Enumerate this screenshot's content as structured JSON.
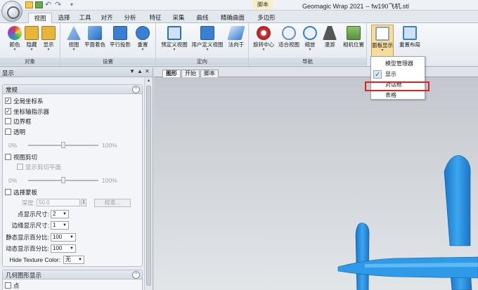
{
  "titlebar": {
    "context_tab": "脚本",
    "window_title": "Geomagic Wrap 2021 -- fw190飞机.stl",
    "quick_access": [
      "new-icon",
      "open-icon",
      "undo-icon",
      "redo-icon"
    ]
  },
  "ribbon_tabs": {
    "items": [
      "视图",
      "选择",
      "工具",
      "对齐",
      "分析",
      "特征",
      "采集",
      "曲线",
      "精确曲面",
      "多边形"
    ],
    "active": "视图"
  },
  "ribbon": {
    "groups": {
      "object": {
        "label": "对象",
        "buttons": [
          {
            "label": "颜色",
            "icon": "color-wheel-icon",
            "color": "#7b5fc7"
          },
          {
            "label": "隐藏",
            "icon": "hide-icon",
            "color": "#e8b53a"
          },
          {
            "label": "显示",
            "icon": "show-icon",
            "color": "#e8b53a"
          }
        ]
      },
      "settings": {
        "label": "设置",
        "buttons": [
          {
            "label": "视图",
            "icon": "view-icon",
            "color": "#5a8fd0"
          },
          {
            "label": "平面着色",
            "icon": "flat-shading-icon",
            "color": "#3b7fd4"
          },
          {
            "label": "平行投影",
            "icon": "parallel-projection-icon",
            "color": "#3b7fd4"
          },
          {
            "label": "重置",
            "icon": "reset-icon",
            "color": "#3b7fd4"
          }
        ]
      },
      "orientation": {
        "label": "定向",
        "buttons": [
          {
            "label": "预定义视图",
            "icon": "predefined-view-icon",
            "color": "#3b7fd4"
          },
          {
            "label": "用户定义视图",
            "icon": "user-view-icon",
            "color": "#3b7fd4"
          },
          {
            "label": "法向于",
            "icon": "normal-to-icon",
            "color": "#3b7fd4"
          }
        ]
      },
      "navigation": {
        "label": "导航",
        "buttons": [
          {
            "label": "旋转中心",
            "icon": "rotation-center-icon",
            "color": "#d43b3b"
          },
          {
            "label": "适合视图",
            "icon": "fit-view-icon",
            "color": "#6f8fb3"
          },
          {
            "label": "缩放",
            "icon": "zoom-icon",
            "color": "#3b7fd4"
          },
          {
            "label": "漫游",
            "icon": "walk-icon",
            "color": "#555555"
          },
          {
            "label": "相机位置",
            "icon": "camera-position-icon",
            "color": "#6fa34c"
          }
        ]
      },
      "layout": {
        "label": "",
        "buttons": [
          {
            "label": "面板显示",
            "icon": "panel-display-icon",
            "color": "#d9a740"
          },
          {
            "label": "重置布局",
            "icon": "reset-layout-icon",
            "color": "#3b7fd4"
          }
        ]
      }
    }
  },
  "panel_menu": {
    "items": [
      "模型管理器",
      "显示",
      "对话框",
      "表格"
    ],
    "checked": "显示",
    "highlighted": "对话框"
  },
  "left_panel": {
    "title": "显示",
    "header_buttons": [
      "▼",
      "▲",
      "✕"
    ],
    "general": {
      "title": "常规",
      "global_cs": {
        "label": "全局坐标系",
        "checked": true
      },
      "axis_indicator": {
        "label": "坐标轴指示器",
        "checked": true
      },
      "bounding_box": {
        "label": "边界框",
        "checked": false
      },
      "transparent": {
        "label": "透明",
        "checked": false
      },
      "transparency_min": "0%",
      "transparency_max": "100%",
      "view_clip": {
        "label": "视图剪切",
        "checked": false
      },
      "show_clip_plane": {
        "label": "显示剪切平面",
        "checked": false
      },
      "clip_min": "0%",
      "clip_max": "100%",
      "select_mask": {
        "label": "选择蒙板",
        "checked": false
      },
      "depth_label": "深度:",
      "depth_value": "50.0",
      "calibrate_button": "校准...",
      "point_size_label": "点显示尺寸:",
      "point_size_value": "2",
      "edge_size_label": "边缘显示尺寸:",
      "edge_size_value": "1",
      "static_pct_label": "静态显示百分比:",
      "static_pct_value": "100",
      "dynamic_pct_label": "动态显示百分比:",
      "dynamic_pct_value": "100",
      "hide_texture_label": "Hide Texture Color:",
      "hide_texture_value": "无"
    },
    "geometry": {
      "title": "几何图形显示",
      "point": {
        "label": "点",
        "checked": false
      }
    }
  },
  "view_tabs": {
    "items": [
      "图形",
      "开始",
      "脚本"
    ],
    "active": "图形"
  },
  "scene": {
    "model_color": "#2f9be8",
    "model_color_dark": "#1b74c7",
    "accent": "#e02020"
  }
}
